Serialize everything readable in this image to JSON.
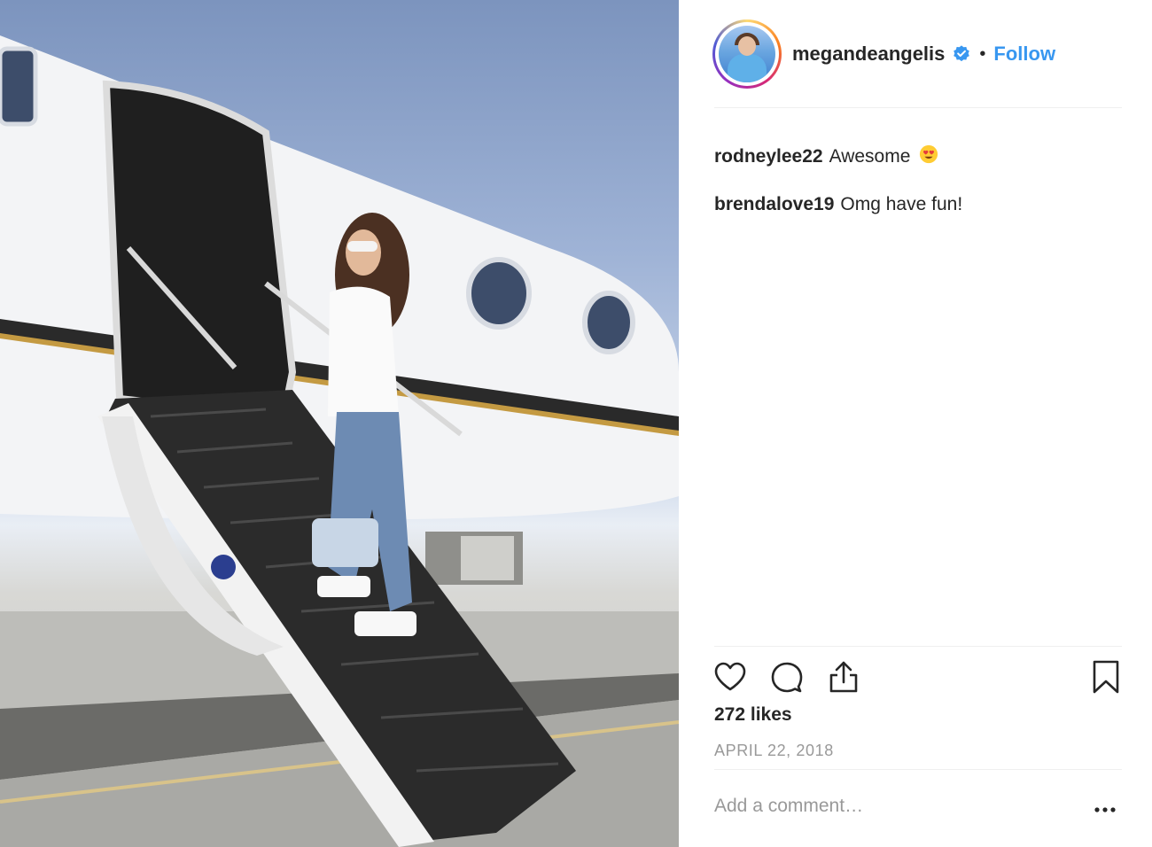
{
  "post": {
    "username": "megandeangelis",
    "separator": "•",
    "follow_label": "Follow",
    "verified": true
  },
  "comments": [
    {
      "user": "rodneylee22",
      "text": "Awesome",
      "emoji": "heart-eyes-emoji"
    },
    {
      "user": "brendalove19",
      "text": "Omg have fun!"
    }
  ],
  "likes": "272 likes",
  "date": "APRIL 22, 2018",
  "add_comment_placeholder": "Add a comment…",
  "icons": {
    "like": "heart-icon",
    "comment": "comment-bubble-icon",
    "share": "share-upload-icon",
    "save": "bookmark-icon",
    "more": "more-options-icon"
  },
  "colors": {
    "accent": "#3897f0",
    "text": "#262626",
    "muted": "#999999"
  }
}
